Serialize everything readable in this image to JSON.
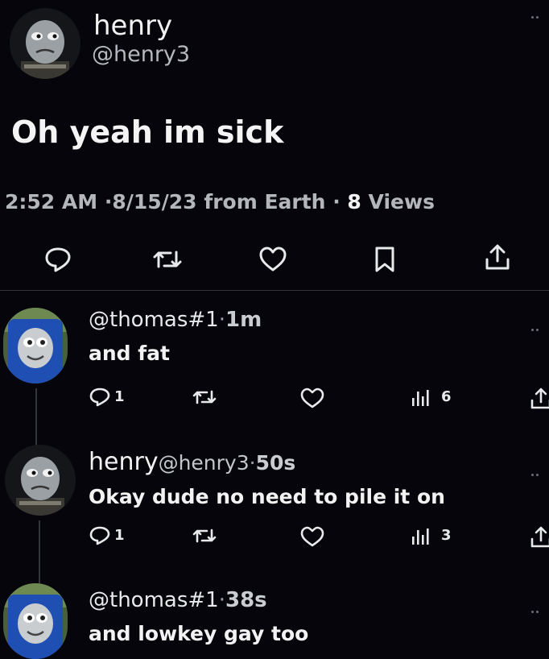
{
  "main_post": {
    "display_name": "henry",
    "handle": "@henry3",
    "text": "Oh yeah im sick",
    "time": "2:52 AM",
    "date": "8/15/23",
    "source": "from Earth",
    "views_count": "8",
    "views_label": "Views",
    "separator": "·"
  },
  "replies": [
    {
      "handle": "@thomas#1",
      "time": "1m",
      "text": "and fat",
      "reply_count": "1",
      "views": "6"
    },
    {
      "display_name": "henry",
      "handle": "@henry3",
      "time": "50s",
      "text": "Okay dude no need to pile it on",
      "reply_count": "1",
      "views": "3"
    },
    {
      "handle": "@thomas#1",
      "time": "38s",
      "text": "and lowkey gay too"
    }
  ],
  "icons": [
    "reply-icon",
    "retweet-icon",
    "like-icon",
    "bookmark-icon",
    "share-icon",
    "views-icon",
    "more-icon"
  ],
  "colors": {
    "background": "#05050b",
    "text": "#e7e9ea",
    "muted": "#8b8f96",
    "divider": "#2f3336"
  }
}
